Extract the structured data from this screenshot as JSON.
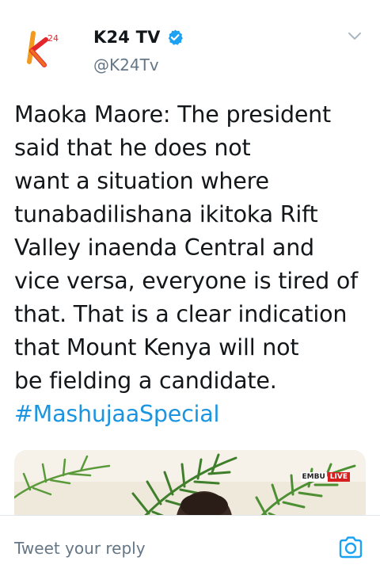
{
  "author": {
    "display_name": "K24 TV",
    "handle": "@K24Tv",
    "verified": true,
    "logo_text": "24"
  },
  "tweet": {
    "lines": [
      "Maoka Maore: The president",
      "said that he does not",
      "want a situation where",
      "tunabadilishana ikitoka Rift",
      "Valley inaenda Central and",
      "vice versa, everyone is tired of",
      "that. That is a clear indication",
      "that Mount Kenya will not",
      "be fielding a candidate."
    ],
    "hashtag": "#MashujaaSpecial"
  },
  "media": {
    "watermark_left": "EMBU",
    "watermark_right": "LIVE"
  },
  "reply": {
    "placeholder": "Tweet your reply"
  },
  "colors": {
    "link": "#1b95e0",
    "verified": "#1da1f2",
    "secondary_text": "#657786",
    "logo_orange": "#f39a1e",
    "logo_red": "#e3262b"
  },
  "icons": {
    "verified": "verified-badge-icon",
    "more": "chevron-down-icon",
    "camera": "camera-icon"
  }
}
